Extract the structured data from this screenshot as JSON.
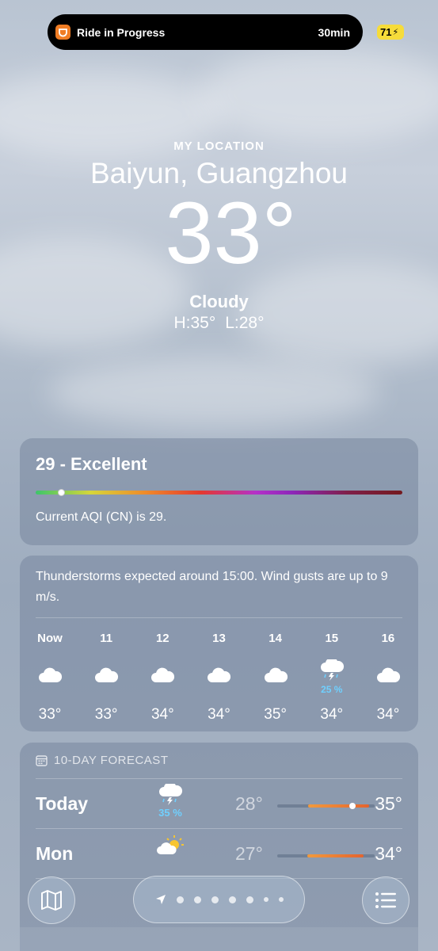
{
  "status_bar": {
    "activity_title": "Ride in Progress",
    "activity_time": "30min",
    "battery": "71"
  },
  "header": {
    "location_label": "MY LOCATION",
    "city": "Baiyun, Guangzhou",
    "temperature": "33°",
    "condition": "Cloudy",
    "high": "H:35°",
    "low": "L:28°"
  },
  "aqi": {
    "title": "29 - Excellent",
    "description": "Current AQI (CN) is 29.",
    "level_fraction": 0.06
  },
  "hourly": {
    "summary": "Thunderstorms expected around 15:00. Wind gusts are up to 9 m/s.",
    "hours": [
      {
        "label": "Now",
        "icon": "cloud-icon",
        "precip": "",
        "temp": "33°"
      },
      {
        "label": "11",
        "icon": "cloud-icon",
        "precip": "",
        "temp": "33°"
      },
      {
        "label": "12",
        "icon": "cloud-icon",
        "precip": "",
        "temp": "34°"
      },
      {
        "label": "13",
        "icon": "cloud-icon",
        "precip": "",
        "temp": "34°"
      },
      {
        "label": "14",
        "icon": "cloud-icon",
        "precip": "",
        "temp": "35°"
      },
      {
        "label": "15",
        "icon": "thunderstorm-icon",
        "precip": "25 %",
        "temp": "34°"
      },
      {
        "label": "16",
        "icon": "cloud-icon",
        "precip": "",
        "temp": "34°"
      }
    ]
  },
  "forecast": {
    "header": "10-DAY FORECAST",
    "days": [
      {
        "day": "Today",
        "icon": "thunderstorm-icon",
        "precip": "35 %",
        "low": "28°",
        "high": "35°"
      },
      {
        "day": "Mon",
        "icon": "partly-sunny-icon",
        "precip": "",
        "low": "27°",
        "high": "34°"
      }
    ]
  },
  "colors": {
    "precip_blue": "#6fd0ff",
    "battery_yellow": "#f6dc3a",
    "app_orange": "#f07d24"
  }
}
